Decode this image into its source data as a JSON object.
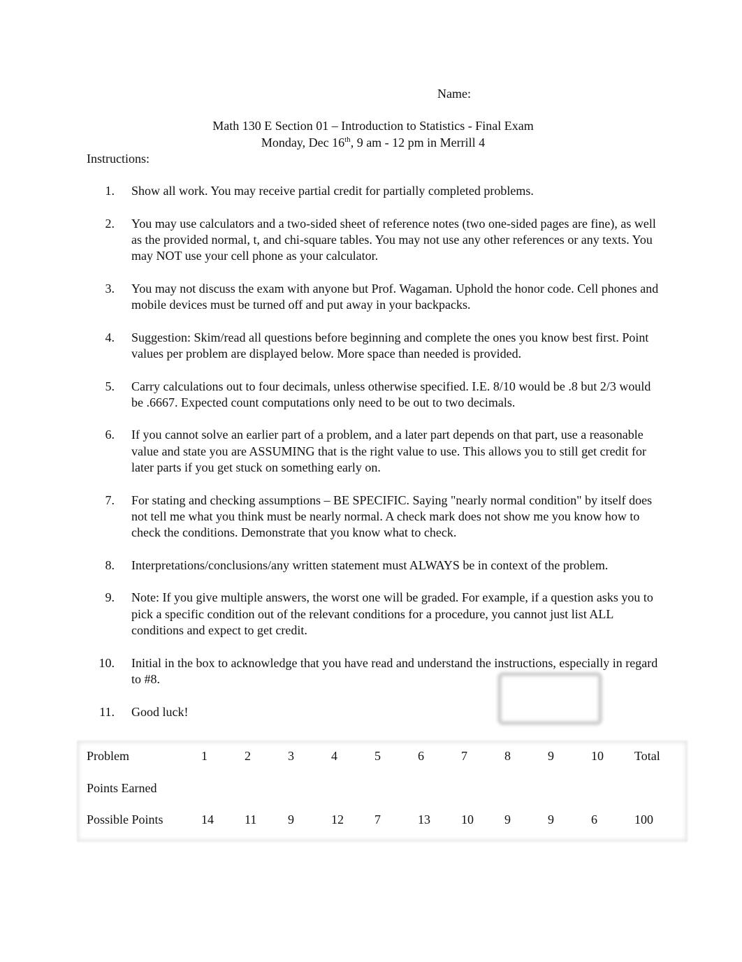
{
  "header": {
    "name_label": "Name:",
    "title": "Math 130 E Section 01 – Introduction to Statistics - Final Exam",
    "subtitle_pre": "Monday, Dec 16",
    "subtitle_sup": "th",
    "subtitle_post": ", 9 am - 12 pm in Merrill 4"
  },
  "instructions": {
    "heading": "Instructions:",
    "items": [
      {
        "num": "1.",
        "text": "Show all work. You may receive partial credit for partially completed problems."
      },
      {
        "num": "2.",
        "text": "You may use calculators and a two-sided sheet of reference notes (two one-sided pages are fine), as well as the provided normal, t, and chi-square tables. You may not use any other references or any texts. You may NOT use your cell phone as your calculator."
      },
      {
        "num": "3.",
        "text": "You may not discuss the exam with anyone but Prof. Wagaman. Uphold the honor code. Cell phones and mobile devices must be turned off and put away in your backpacks."
      },
      {
        "num": "4.",
        "text": "Suggestion: Skim/read all questions before beginning and complete the ones you know best first. Point values per problem are displayed below. More space than needed is provided."
      },
      {
        "num": "5.",
        "text": "Carry calculations out to four decimals, unless otherwise specified. I.E. 8/10 would be .8 but 2/3 would be .6667. Expected count computations only need to be out to two decimals."
      },
      {
        "num": "6.",
        "text": "If you cannot solve an earlier part of a problem, and a later part depends on that part, use a reasonable value and state you are ASSUMING that is the right value to use. This allows you to still get credit for later parts if you get stuck on something early on."
      },
      {
        "num": "7.",
        "text": "For stating and checking assumptions – BE SPECIFIC. Saying \"nearly normal condition\" by itself does not tell me what you think must be nearly normal. A check mark does not show me you know how to check the conditions. Demonstrate that you know what to check."
      },
      {
        "num": "8.",
        "text": "Interpretations/conclusions/any written statement must ALWAYS be in context of the problem."
      },
      {
        "num": "9.",
        "text": "Note: If you give multiple answers, the worst one will be graded. For example, if a question asks you to pick a specific condition out of the relevant conditions for a procedure, you cannot just list ALL conditions and expect to get credit."
      },
      {
        "num": "10.",
        "text": "Initial in the box to acknowledge that you have read and understand the instructions, especially in regard to #8."
      },
      {
        "num": "11.",
        "text": "Good luck!"
      }
    ]
  },
  "score_table": {
    "rows": [
      {
        "label": "Problem",
        "cells": [
          "1",
          "2",
          "3",
          "4",
          "5",
          "6",
          "7",
          "8",
          "9",
          "10",
          "Total"
        ]
      },
      {
        "label": "Points Earned",
        "cells": [
          "",
          "",
          "",
          "",
          "",
          "",
          "",
          "",
          "",
          "",
          ""
        ]
      },
      {
        "label": "Possible Points",
        "cells": [
          "14",
          "11",
          "9",
          "12",
          "7",
          "13",
          "10",
          "9",
          "9",
          "6",
          "100"
        ]
      }
    ]
  }
}
